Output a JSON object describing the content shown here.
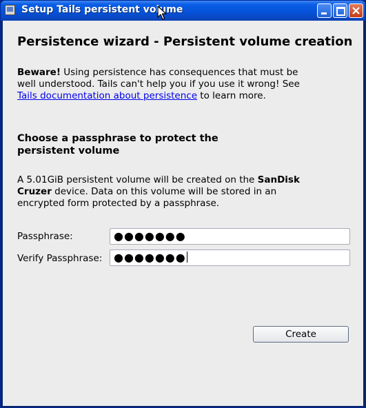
{
  "window": {
    "title": "Setup Tails persistent volume"
  },
  "wizard": {
    "heading": "Persistence wizard - Persistent volume creation",
    "warning": {
      "bold": "Beware!",
      "text_before_link": " Using persistence has consequences that must be well understood. Tails can't help you if you use it wrong! See ",
      "link_text": "Tails documentation about persistence",
      "text_after_link": " to learn more."
    },
    "subheading": "Choose a passphrase to protect the persistent volume",
    "info": {
      "text_before_device": "A 5.01GiB persistent volume will be created on the ",
      "device": "SanDisk Cruzer",
      "text_after_device": " device. Data on this volume will be stored in an encrypted form protected by a passphrase."
    },
    "passphrase": {
      "label": "Passphrase:",
      "value": "●●●●●●●"
    },
    "verify_passphrase": {
      "label": "Verify Passphrase:",
      "value": "●●●●●●●"
    },
    "create_button": "Create"
  },
  "icons": {
    "window_icon": "window-icon",
    "minimize": "minimize-icon",
    "maximize": "maximize-icon",
    "close": "close-icon",
    "cursor": "mouse-pointer-icon"
  },
  "colors": {
    "titlebar": "#0553d9",
    "link": "#0000ee",
    "client_bg": "#ececec"
  }
}
